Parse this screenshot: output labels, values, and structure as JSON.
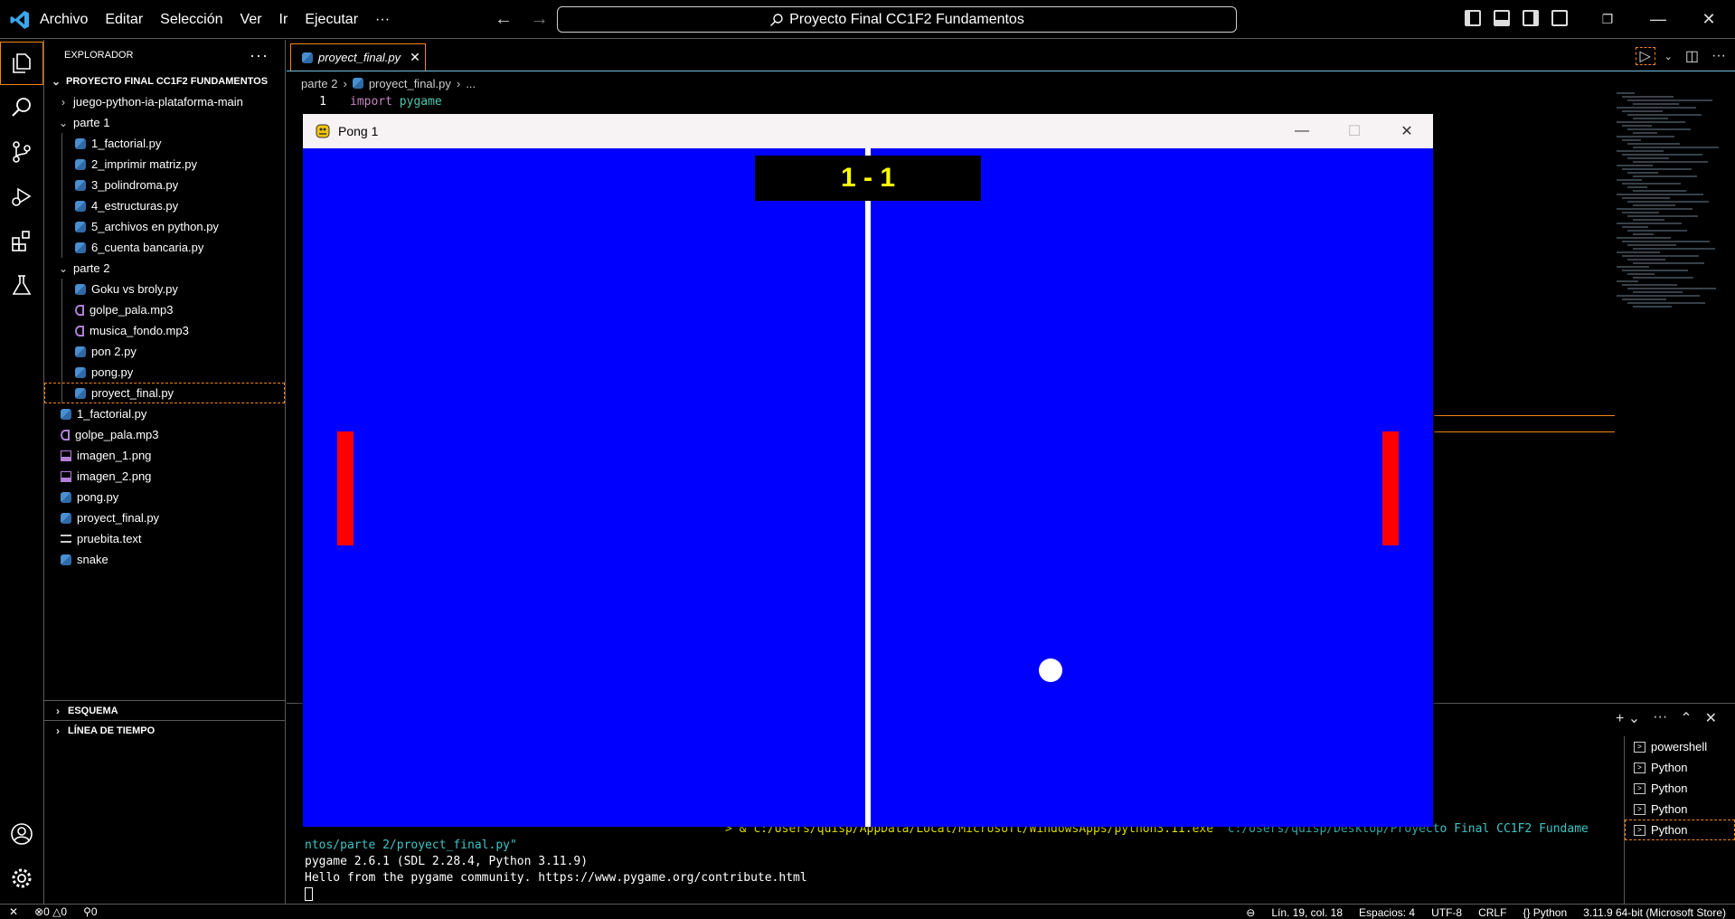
{
  "window": {
    "search_text": "Proyecto Final CC1F2 Fundamentos",
    "menu": [
      "Archivo",
      "Editar",
      "Selección",
      "Ver",
      "Ir",
      "Ejecutar"
    ],
    "more": "···"
  },
  "sidebar": {
    "title": "EXPLORADOR",
    "root": "PROYECTO FINAL CC1F2 FUNDAMENTOS",
    "items": [
      {
        "label": "juego-python-ia-plataforma-main",
        "kind": "folder-closed",
        "depth": 1
      },
      {
        "label": "parte 1",
        "kind": "folder-open",
        "depth": 1
      },
      {
        "label": "1_factorial.py",
        "kind": "py",
        "depth": 2
      },
      {
        "label": "2_imprimir matriz.py",
        "kind": "py",
        "depth": 2
      },
      {
        "label": "3_polindroma.py",
        "kind": "py",
        "depth": 2
      },
      {
        "label": "4_estructuras.py",
        "kind": "py",
        "depth": 2
      },
      {
        "label": "5_archivos en python.py",
        "kind": "py",
        "depth": 2
      },
      {
        "label": "6_cuenta bancaria.py",
        "kind": "py",
        "depth": 2
      },
      {
        "label": "parte 2",
        "kind": "folder-open",
        "depth": 1
      },
      {
        "label": "Goku vs broly.py",
        "kind": "py",
        "depth": 2
      },
      {
        "label": "golpe_pala.mp3",
        "kind": "audio",
        "depth": 2
      },
      {
        "label": "musica_fondo.mp3",
        "kind": "audio",
        "depth": 2
      },
      {
        "label": "pon 2.py",
        "kind": "py",
        "depth": 2
      },
      {
        "label": "pong.py",
        "kind": "py",
        "depth": 2
      },
      {
        "label": "proyect_final.py",
        "kind": "py",
        "depth": 2,
        "selected": true
      },
      {
        "label": "1_factorial.py",
        "kind": "py",
        "depth": 1
      },
      {
        "label": "golpe_pala.mp3",
        "kind": "audio",
        "depth": 1
      },
      {
        "label": "imagen_1.png",
        "kind": "img",
        "depth": 1
      },
      {
        "label": "imagen_2.png",
        "kind": "img",
        "depth": 1
      },
      {
        "label": "pong.py",
        "kind": "py",
        "depth": 1
      },
      {
        "label": "proyect_final.py",
        "kind": "py",
        "depth": 1
      },
      {
        "label": "pruebita.text",
        "kind": "txt",
        "depth": 1
      },
      {
        "label": "snake",
        "kind": "py",
        "depth": 1
      }
    ],
    "outline": "ESQUEMA",
    "timeline": "LÍNEA DE TIEMPO"
  },
  "editor": {
    "tab": "proyect_final.py",
    "breadcrumb": [
      "parte 2",
      "proyect_final.py",
      "..."
    ],
    "line_number": "1",
    "code_kw": "import",
    "code_mod": "pygame"
  },
  "pong": {
    "title": "Pong 1",
    "score": "1 - 1"
  },
  "terminal": {
    "cmd_prefix": "> & ",
    "cmd_exe": "c:/Users/quisp/AppData/Local/Microsoft/WindowsApps/python3.11.exe",
    "cmd_arg1": " \"c:/Users/quisp/Desktop/Proyecto Final CC1F2 Fundame",
    "cmd_arg2": "ntos/parte 2/proyect_final.py\"",
    "line2": "pygame 2.6.1 (SDL 2.28.4, Python 3.11.9)",
    "line3": "Hello from the pygame community. https://www.pygame.org/contribute.html",
    "list": [
      "powershell",
      "Python",
      "Python",
      "Python",
      "Python"
    ]
  },
  "status": {
    "errors": "0",
    "warnings": "0",
    "ports": "0",
    "position": "Lín. 19, col. 18",
    "spaces": "Espacios: 4",
    "encoding": "UTF-8",
    "eol": "CRLF",
    "lang": "Python",
    "interpreter": "3.11.9 64-bit (Microsoft Store)"
  },
  "colors": {
    "accent": "#f38518",
    "pong_bg": "#0000ff",
    "paddle": "#ff0000",
    "score": "#ffff00"
  }
}
